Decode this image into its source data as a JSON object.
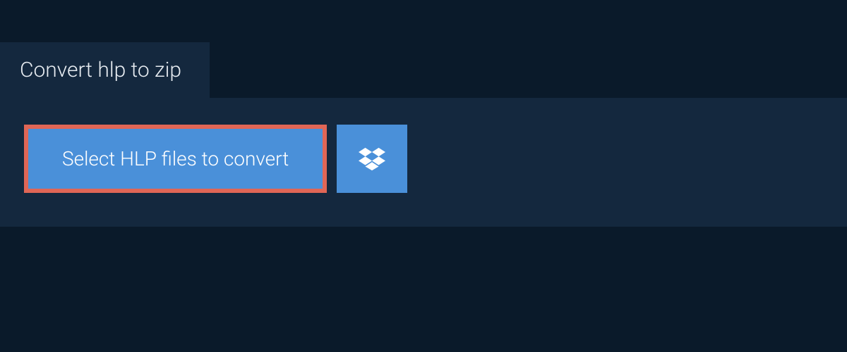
{
  "tab": {
    "title": "Convert hlp to zip"
  },
  "actions": {
    "select_label": "Select HLP files to convert"
  },
  "colors": {
    "bg": "#0a1a2a",
    "panel": "#14283e",
    "button": "#4a90d9",
    "highlight_border": "#e06656"
  }
}
